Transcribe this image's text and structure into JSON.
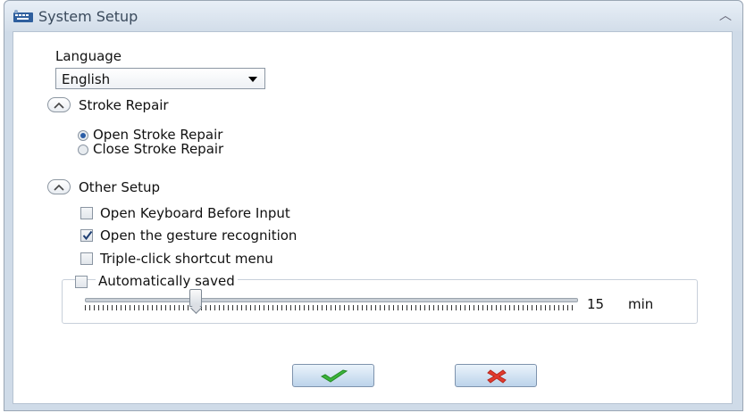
{
  "window": {
    "title": "System Setup",
    "app_icon": "keyboard-app-icon"
  },
  "language": {
    "label": "Language",
    "selected": "English"
  },
  "stroke_repair": {
    "header": "Stroke Repair",
    "options": [
      {
        "label": "Open Stroke Repair",
        "selected": true
      },
      {
        "label": "Close Stroke Repair",
        "selected": false
      }
    ]
  },
  "other_setup": {
    "header": "Other Setup",
    "options": [
      {
        "label": "Open Keyboard Before Input",
        "checked": false
      },
      {
        "label": "Open the gesture recognition",
        "checked": true
      },
      {
        "label": "Triple-click shortcut menu",
        "checked": false
      },
      {
        "label": "Automatically saved",
        "checked": false
      }
    ]
  },
  "autosave": {
    "value": "15",
    "unit": "min",
    "slider_fraction": 0.25
  },
  "buttons": {
    "ok": "check-icon",
    "cancel": "cross-icon"
  },
  "colors": {
    "ok_green": "#3bb43b",
    "cancel_red": "#e23b2e",
    "title_text": "#3a4a5c"
  }
}
